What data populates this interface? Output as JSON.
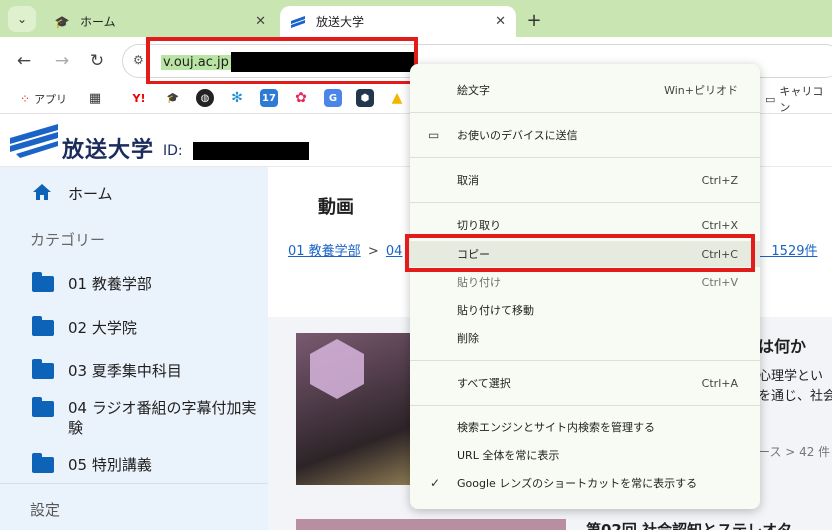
{
  "tabs": [
    {
      "title": "ホーム",
      "active": false
    },
    {
      "title": "放送大学",
      "active": true
    }
  ],
  "toolbar": {
    "url_visible": "v.ouj.ac.jp"
  },
  "bookmarks": {
    "apps_label": "アプリ",
    "folder_label": "キャリコン"
  },
  "header": {
    "logo_text": "放送大学",
    "id_label": "ID:"
  },
  "sidebar": {
    "home": "ホーム",
    "category_label": "カテゴリー",
    "items": [
      {
        "label": "01 教養学部"
      },
      {
        "label": "02 大学院"
      },
      {
        "label": "03 夏季集中科目"
      },
      {
        "label": "04 ラジオ番組の字幕付加実験"
      },
      {
        "label": "05 特別講義"
      }
    ],
    "settings": "設定"
  },
  "main": {
    "heading": "動画",
    "crumb_first": "01 教養学部",
    "crumb_sep": ">",
    "crumb_second": "04",
    "crumb_right": "0） 1529件",
    "card": {
      "title": "は何か",
      "line1": "心理学とい",
      "line2": "を通じ、社会",
      "meta": "ース > 42 件"
    },
    "next_title": "第02回 社会認知とステレオタ"
  },
  "context_menu": {
    "items": [
      {
        "label": "絵文字",
        "shortcut": "Win+ピリオド"
      },
      {
        "label": "お使いのデバイスに送信",
        "shortcut": ""
      },
      {
        "label": "取消",
        "shortcut": "Ctrl+Z"
      },
      {
        "label": "切り取り",
        "shortcut": "Ctrl+X"
      },
      {
        "label": "コピー",
        "shortcut": "Ctrl+C"
      },
      {
        "label": "貼り付け",
        "shortcut": "Ctrl+V"
      },
      {
        "label": "貼り付けて移動",
        "shortcut": ""
      },
      {
        "label": "削除",
        "shortcut": ""
      },
      {
        "label": "すべて選択",
        "shortcut": "Ctrl+A"
      },
      {
        "label": "検索エンジンとサイト内検索を管理する",
        "shortcut": ""
      },
      {
        "label": "URL 全体を常に表示",
        "shortcut": ""
      },
      {
        "label": "Google レンズのショートカットを常に表示する",
        "shortcut": ""
      }
    ],
    "highlighted": "コピー"
  },
  "colors": {
    "tabstrip": "#c9e6b2",
    "highlight_box": "#e21b1b",
    "link": "#1a64c7",
    "folder": "#0d63b8",
    "sidebar_bg": "#eaf2fb"
  }
}
